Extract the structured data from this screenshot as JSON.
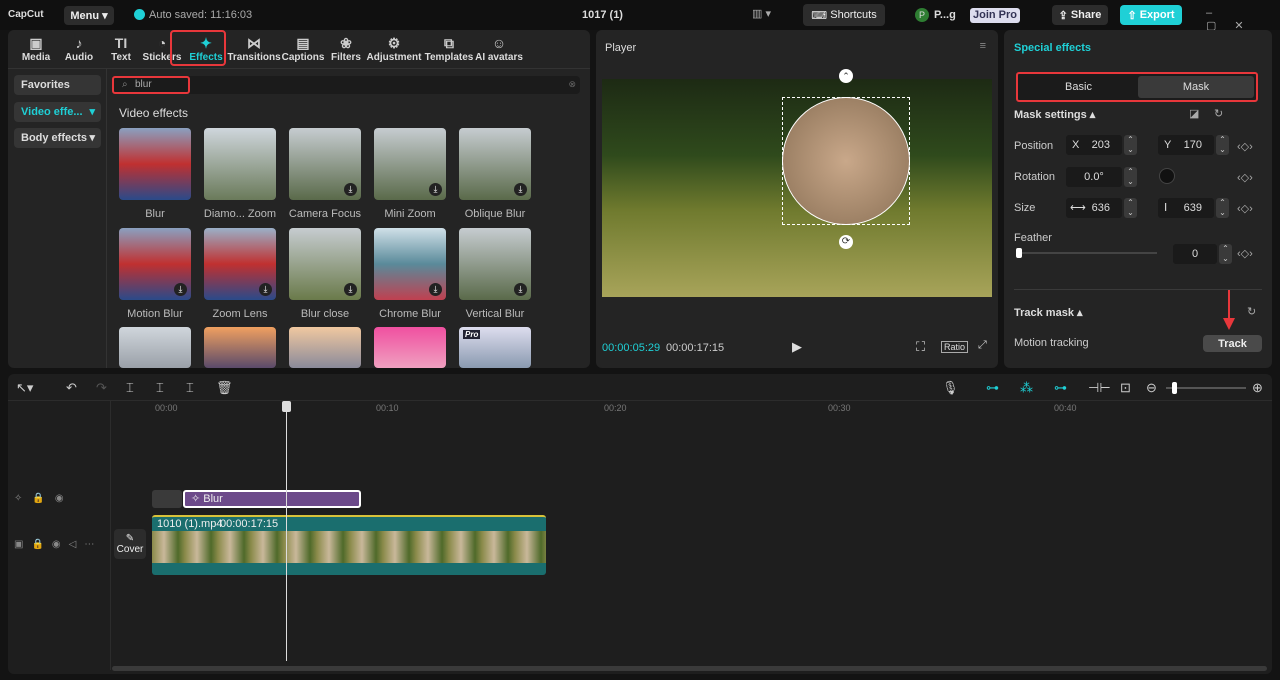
{
  "app": {
    "logo": "CapCut",
    "menu": "Menu",
    "autosave": "Auto saved: 11:16:03",
    "title": "1017 (1)",
    "shortcuts": "Shortcuts",
    "user": "P...g",
    "user_initial": "P",
    "join_pro": "Join Pro",
    "share": "Share",
    "export": "Export"
  },
  "tabs": [
    {
      "label": "Media",
      "icon": "▣"
    },
    {
      "label": "Audio",
      "icon": "♪"
    },
    {
      "label": "Text",
      "icon": "TI"
    },
    {
      "label": "Stickers",
      "icon": "◔"
    },
    {
      "label": "Effects",
      "icon": "✦"
    },
    {
      "label": "Transitions",
      "icon": "⋈"
    },
    {
      "label": "Captions",
      "icon": "▤"
    },
    {
      "label": "Filters",
      "icon": "❀"
    },
    {
      "label": "Adjustment",
      "icon": "⚙"
    },
    {
      "label": "Templates",
      "icon": "⧉"
    },
    {
      "label": "AI avatars",
      "icon": "☺"
    }
  ],
  "categories": [
    "Favorites",
    "Video effe...",
    "Body effects"
  ],
  "search": {
    "value": "blur"
  },
  "section_title": "Video effects",
  "effects": [
    {
      "name": "Blur"
    },
    {
      "name": "Diamo... Zoom"
    },
    {
      "name": "Camera Focus"
    },
    {
      "name": "Mini Zoom"
    },
    {
      "name": "Oblique Blur"
    },
    {
      "name": "Motion Blur"
    },
    {
      "name": "Zoom Lens"
    },
    {
      "name": "Blur close"
    },
    {
      "name": "Chrome Blur"
    },
    {
      "name": "Vertical Blur"
    }
  ],
  "pro_badge": "Pro",
  "player": {
    "title": "Player",
    "current": "00:00:05:29",
    "total": "00:00:17:15",
    "ratio": "Ratio"
  },
  "right": {
    "title": "Special effects",
    "tab_basic": "Basic",
    "tab_mask": "Mask",
    "mask_settings": "Mask settings",
    "position": "Position",
    "x_label": "X",
    "x": "203",
    "y_label": "Y",
    "y": "170",
    "rotation": "Rotation",
    "rotation_value": "0.0°",
    "size": "Size",
    "width": "636",
    "height": "639",
    "feather": "Feather",
    "feather_value": "0",
    "feather_fraction": 0,
    "track_mask": "Track mask",
    "motion_tracking": "Motion tracking",
    "track": "Track"
  },
  "timeline": {
    "ticks": [
      "00:00",
      "00:10",
      "00:20",
      "00:30",
      "00:40"
    ],
    "effect_clip": "Blur",
    "video_clip": "1010 (1).mp4",
    "video_duration": "00:00:17:15",
    "cover": "Cover"
  },
  "colors": {
    "accent": "#1fd0d6",
    "highlight": "#e8373b",
    "effect_clip": "#6c4a8a"
  }
}
